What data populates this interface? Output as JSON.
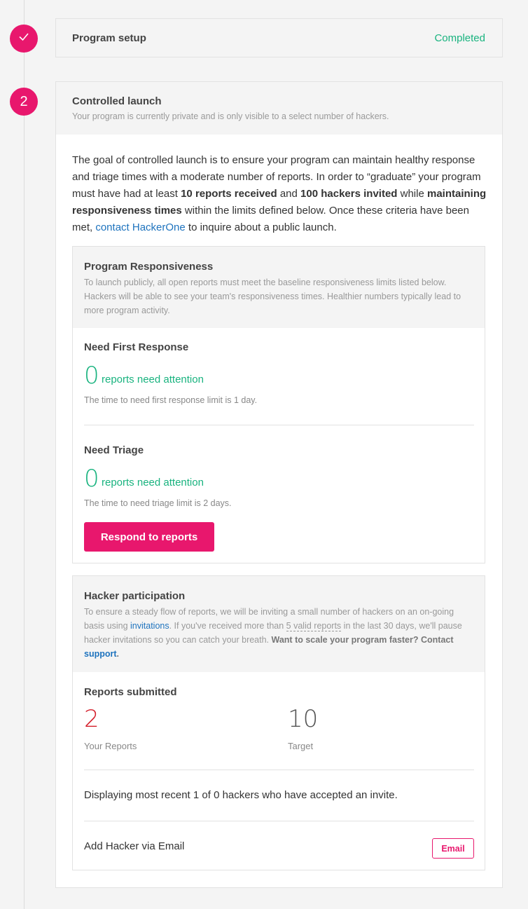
{
  "steps": {
    "setup": {
      "icon": "check-icon",
      "title": "Program setup",
      "status": "Completed"
    },
    "launch": {
      "number": "2",
      "title": "Controlled launch",
      "subtitle": "Your program is currently private and is only visible to a select number of hackers."
    }
  },
  "intro": {
    "t1": "The goal of controlled launch is to ensure your program can maintain healthy response and triage times with a moderate number of reports. In order to “graduate” your program must have had at least ",
    "b1": "10 reports received",
    "t2": " and ",
    "b2": "100 hackers invited",
    "t3": " while ",
    "b3": "maintaining responsiveness times",
    "t4": " within the limits defined below. Once these criteria have been met, ",
    "link": "contact HackerOne",
    "t5": " to inquire about a public launch."
  },
  "responsiveness": {
    "title": "Program Responsiveness",
    "description": "To launch publicly, all open reports must meet the baseline responsiveness limits listed below. Hackers will be able to see your team's responsiveness times. Healthier numbers typically lead to more program activity.",
    "first_response": {
      "title": "Need First Response",
      "count": "0",
      "count_label": "reports need attention",
      "note": "The time to need first response limit is 1 day."
    },
    "triage": {
      "title": "Need Triage",
      "count": "0",
      "count_label": "reports need attention",
      "note": "The time to need triage limit is 2 days."
    },
    "button": "Respond to reports"
  },
  "participation": {
    "title": "Hacker participation",
    "d1": "To ensure a steady flow of reports, we will be inviting a small number of hackers on an on-going basis using ",
    "d_link1": "invitations",
    "d2": ". If you've received more than ",
    "d_dash": "5 valid reports",
    "d3": " in the last 30 days, we'll pause hacker invitations so you can catch your breath. ",
    "d_bold": "Want to scale your program faster? Contact ",
    "d_link2": "support",
    "d4": ".",
    "reports_title": "Reports submitted",
    "your_reports": "2",
    "your_reports_label": "Your Reports",
    "target": "10",
    "target_label": "Target",
    "displaying": "Displaying most recent 1 of 0 hackers who have accepted an invite.",
    "add_hacker": "Add Hacker via Email",
    "email_button": "Email"
  },
  "colors": {
    "accent": "#e8176d",
    "success": "#19b37f",
    "danger": "#d41f2b",
    "link": "#1e73be"
  }
}
